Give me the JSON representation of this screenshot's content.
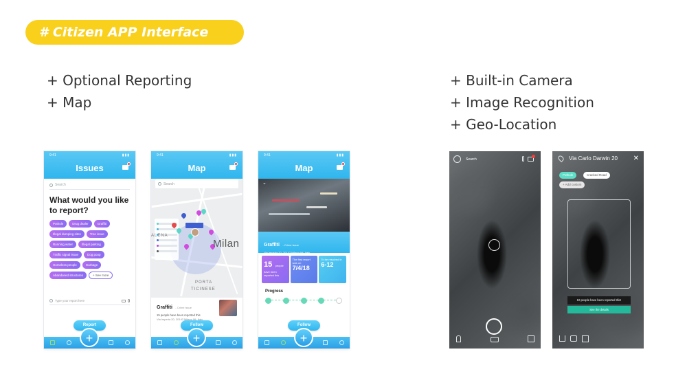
{
  "slide": {
    "title": "# Citizen APP Interface",
    "left_features": [
      "+ Optional Reporting",
      "+ Map"
    ],
    "right_features": [
      "+ Built-in Camera",
      "+ Image Recognition",
      "+ Geo-Location"
    ]
  },
  "colors": {
    "accent_yellow": "#f9d01b",
    "app_blue": "#2fb6ee",
    "chip_purple": "#8a6cf2",
    "teal": "#25b99b"
  },
  "phone_status": {
    "time": "9:41"
  },
  "issues_screen": {
    "title": "Issues",
    "search_placeholder": "Search",
    "question": "What would you like to report?",
    "categories": [
      "Pothole",
      "Drug dealer",
      "Graffiti",
      "Illegal dumping sites",
      "Tree issue",
      "Running water",
      "Illegal parking",
      "Traffic signal issue",
      "Dog poop",
      "Homeless people",
      "Garbage",
      "Abandoned structures"
    ],
    "see_more": "+ See more",
    "report_placeholder": "Type your report here",
    "report_button": "Report",
    "fab": "+"
  },
  "map_screen": {
    "title": "Map",
    "search_placeholder": "Search",
    "city_label": "Milan",
    "area_labels": [
      "ALENA",
      "PORTA",
      "TICINESE"
    ],
    "card": {
      "name": "Graffiti",
      "category": "- Crime issue",
      "reports": "15 people have been reported this",
      "address": "Via Imperia 20, 20142 Milano MI, Italy"
    },
    "follow_button": "Follow"
  },
  "detail_screen": {
    "title": "Map",
    "name": "Graffiti",
    "category": "- Crime issue",
    "address": "Via Imperia 20, 20142 Milano MI, Italy",
    "stats": [
      {
        "big": "15",
        "unit": "people",
        "small": "have been reported this"
      },
      {
        "small": "The first report was on",
        "big": "7/4/18"
      },
      {
        "small": "To be resolved in",
        "big": "6-12"
      }
    ],
    "progress_label": "Progress",
    "follow_button": "Follow"
  },
  "camera_screen": {
    "search_placeholder": "Search"
  },
  "recognition_screen": {
    "location": "Via Carlo Darwin 20",
    "close": "✕",
    "tags": [
      "Pothole",
      "Cracked Road"
    ],
    "add_custom": "+ Add custom",
    "detected_text": "10 people have been reported this!",
    "see_details": "See the details"
  }
}
